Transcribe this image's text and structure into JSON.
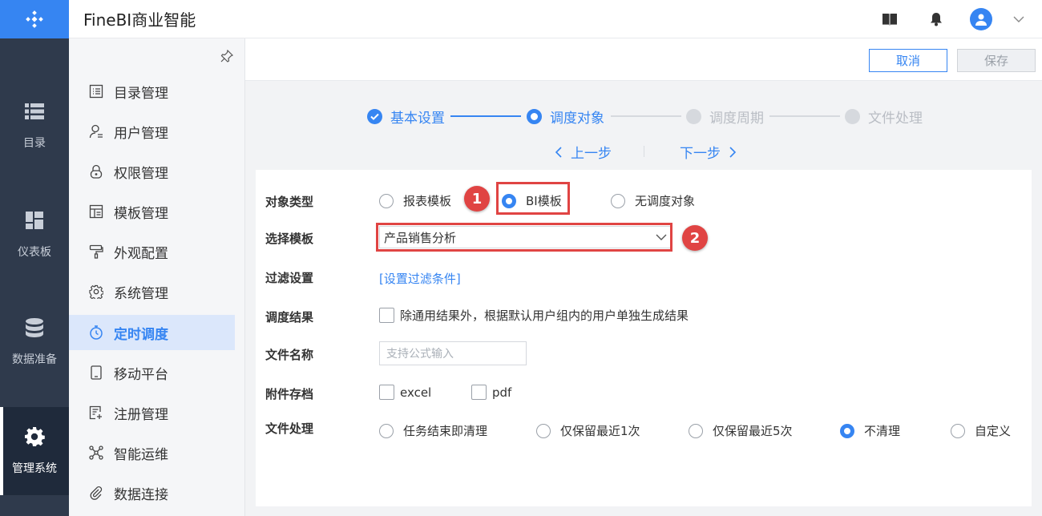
{
  "header": {
    "title": "FineBI商业智能"
  },
  "rail": {
    "items": [
      {
        "label": "目录",
        "icon": "list-icon"
      },
      {
        "label": "仪表板",
        "icon": "dashboard-icon"
      },
      {
        "label": "数据准备",
        "icon": "database-icon"
      },
      {
        "label": "管理系统",
        "icon": "gear-icon",
        "active": true
      }
    ]
  },
  "sidebar": {
    "items": [
      {
        "label": "目录管理",
        "icon": "catalog-icon"
      },
      {
        "label": "用户管理",
        "icon": "user-icon"
      },
      {
        "label": "权限管理",
        "icon": "lock-icon"
      },
      {
        "label": "模板管理",
        "icon": "template-icon"
      },
      {
        "label": "外观配置",
        "icon": "paint-icon"
      },
      {
        "label": "系统管理",
        "icon": "settings-icon"
      },
      {
        "label": "定时调度",
        "icon": "stopwatch-icon",
        "active": true
      },
      {
        "label": "移动平台",
        "icon": "mobile-icon"
      },
      {
        "label": "注册管理",
        "icon": "register-icon"
      },
      {
        "label": "智能运维",
        "icon": "network-icon"
      },
      {
        "label": "数据连接",
        "icon": "paperclip-icon"
      }
    ]
  },
  "toolbar": {
    "cancel_label": "取消",
    "save_label": "保存"
  },
  "steps": [
    {
      "label": "基本设置",
      "state": "done"
    },
    {
      "label": "调度对象",
      "state": "current"
    },
    {
      "label": "调度周期",
      "state": "pending"
    },
    {
      "label": "文件处理",
      "state": "pending"
    }
  ],
  "nav": {
    "prev_label": "上一步",
    "next_label": "下一步"
  },
  "form": {
    "object_type": {
      "label": "对象类型",
      "options": [
        "报表模板",
        "BI模板",
        "无调度对象"
      ],
      "selected": "BI模板"
    },
    "template": {
      "label": "选择模板",
      "value": "产品销售分析"
    },
    "filter": {
      "label": "过滤设置",
      "link": "[设置过滤条件]"
    },
    "result": {
      "label": "调度结果",
      "checkbox_label": "除通用结果外，根据默认用户组内的用户单独生成结果",
      "checked": false
    },
    "file_name": {
      "label": "文件名称",
      "placeholder": "支持公式输入"
    },
    "attachment": {
      "label": "附件存档",
      "options": [
        "excel",
        "pdf"
      ]
    },
    "file_processing": {
      "label": "文件处理",
      "options": [
        "任务结束即清理",
        "仅保留最近1次",
        "仅保留最近5次",
        "不清理",
        "自定义"
      ],
      "selected": "不清理"
    }
  },
  "annotations": {
    "badge1": "1",
    "badge2": "2"
  },
  "colors": {
    "accent": "#3685f2",
    "rail": "#2f3a4c",
    "highlight": "#e04443"
  }
}
